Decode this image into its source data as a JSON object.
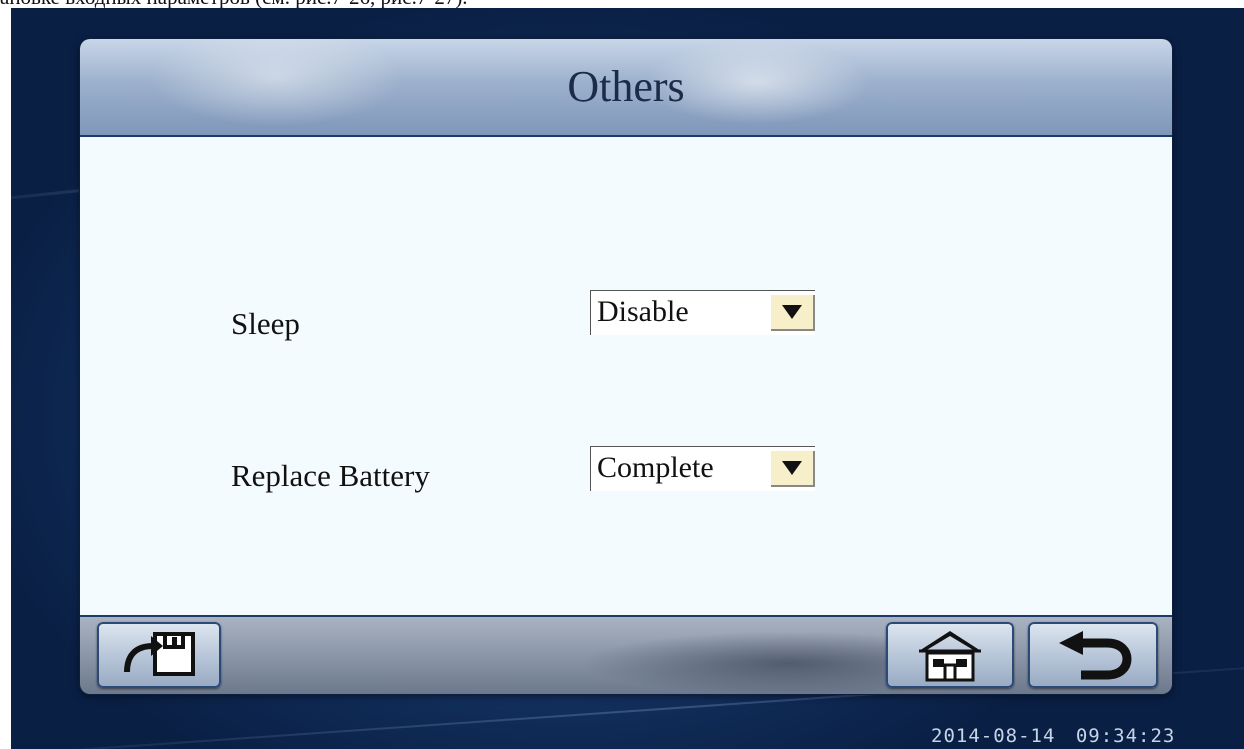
{
  "header": {
    "title": "Others"
  },
  "settings": {
    "sleep": {
      "label": "Sleep",
      "value": "Disable"
    },
    "replace_battery": {
      "label": "Replace Battery",
      "value": "Complete"
    }
  },
  "toolbar": {
    "save_icon": "save-floppy-icon",
    "home_icon": "home-icon",
    "back_icon": "back-arrow-icon"
  },
  "status": {
    "date": "2014-08-14",
    "time": "09:34:23"
  },
  "page_caption": "ановке входных параметров (см. рис.7-26, рис.7-27)."
}
